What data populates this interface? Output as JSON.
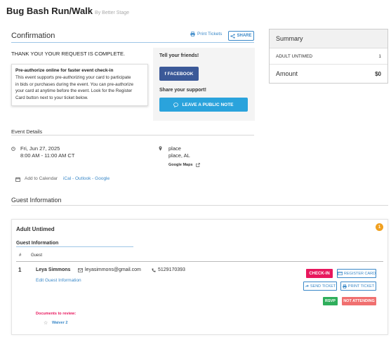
{
  "page": {
    "title": "Bug Bash Run/Walk",
    "by_line": "By Better Stage"
  },
  "confirmation": {
    "heading": "Confirmation",
    "print_tickets": "Print Tickets",
    "share": "SHARE",
    "thank_you": "THANK YOU! YOUR REQUEST IS COMPLETE."
  },
  "preauth": {
    "title": "Pre-authorize online for faster event check-in",
    "lines": [
      "This event supports pre-authorizing your card to participate",
      "in bids or purchases during the event. You can pre-authorize",
      "your card at anytime before the event. Look for the Register",
      "Card button next to your ticket below."
    ]
  },
  "social": {
    "tell_friends": "Tell your friends!",
    "facebook": "FACEBOOK",
    "share_support": "Share your support!",
    "public_note": "LEAVE A PUBLIC NOTE"
  },
  "summary": {
    "heading": "Summary",
    "item_label": "ADULT UNTIMED",
    "item_qty": "1",
    "amount_label": "Amount",
    "amount_value": "$0"
  },
  "event_details": {
    "heading": "Event Details",
    "date": "Fri, Jun 27, 2025",
    "time": "8:00 AM - 11:00 AM CT",
    "place_name": "place",
    "place_city": "place, AL",
    "map_link": "Google Maps",
    "add_to_calendar": "Add to Calendar",
    "ical": "iCal",
    "outlook": "Outlook",
    "google": "Google",
    "sep": " - "
  },
  "guest_info": {
    "heading": "Guest Information",
    "ticket_name": "Adult Untimed",
    "count_badge": "1",
    "subheading": "Guest Information",
    "col_num": "#",
    "col_guest": "Guest",
    "row_num": "1",
    "guest_name": "Leya Simmons",
    "guest_email": "leyasimmons@gmail.com",
    "guest_phone": "5129170393",
    "edit_link": "Edit Guest Information",
    "checkin": "CHECK-IN",
    "register_card": "REGISTER CARD",
    "send_ticket": "SEND TICKET",
    "print_ticket": "PRINT TICKET",
    "rsvp": "RSVP",
    "not_attending": "NOT ATTENDING",
    "documents_label": "Documents to review:",
    "waiver": "Waiver 2"
  },
  "colors": {
    "accent": "#3a88c8",
    "facebook": "#3b5998",
    "note": "#2aa3dc",
    "checkin": "#e8175d",
    "rsvp": "#2eae5b",
    "not_attending": "#f06f6f",
    "badge": "#f0a020"
  }
}
